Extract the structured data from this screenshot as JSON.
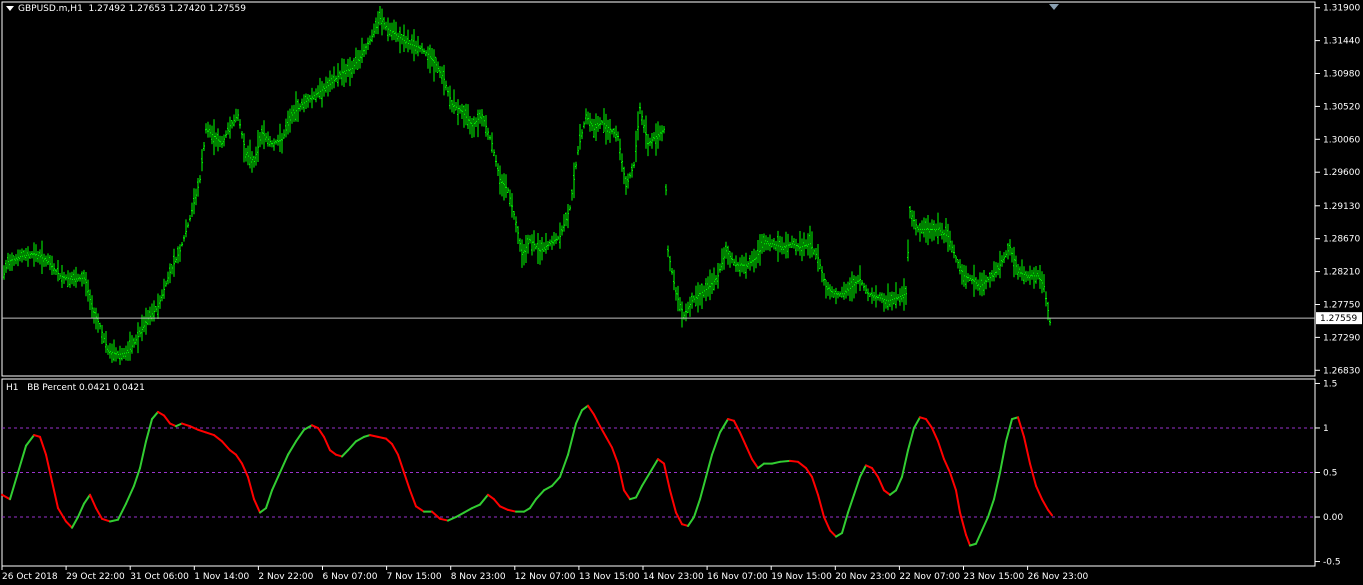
{
  "main_header": {
    "symbol": "GBPUSD.m,H1",
    "ohlc": "1.27492 1.27653 1.27420 1.27559"
  },
  "indicator_header": {
    "timeframe": "H1",
    "label": "BB Percent 0.0421 0.0421"
  },
  "colors": {
    "background": "#000000",
    "frame": "#ffffff",
    "bars": "#00ff00",
    "bb_up": "#32cd32",
    "bb_down": "#ff0000",
    "level_lines": "#9932cc",
    "price_line": "#c0c0c0"
  },
  "icons": {
    "collapse": "triangle-down-icon",
    "scroll_marker": "triangle-down-icon"
  },
  "chart_data": [
    {
      "type": "ohlc",
      "symbol": "GBPUSD.m",
      "timeframe": "H1",
      "y_ticks": [
        1.319,
        1.3144,
        1.3098,
        1.3052,
        1.3006,
        1.296,
        1.2913,
        1.2867,
        1.2821,
        1.2775,
        1.2729,
        1.2683
      ],
      "y_tick_labels": [
        "1.31900",
        "1.31440",
        "1.30980",
        "1.30520",
        "1.30060",
        "1.29600",
        "1.29130",
        "1.28670",
        "1.28210",
        "1.27750",
        "1.27290",
        "1.26830"
      ],
      "ylim": [
        1.2675,
        1.3198
      ],
      "current_price": 1.27559,
      "current_price_label": "1.27559",
      "close_path": [
        [
          0,
          1.28
        ],
        [
          8,
          1.2835
        ],
        [
          20,
          1.2842
        ],
        [
          35,
          1.2846
        ],
        [
          48,
          1.2835
        ],
        [
          60,
          1.2815
        ],
        [
          72,
          1.281
        ],
        [
          85,
          1.2812
        ],
        [
          92,
          1.277
        ],
        [
          100,
          1.2745
        ],
        [
          108,
          1.271
        ],
        [
          118,
          1.2705
        ],
        [
          128,
          1.2708
        ],
        [
          138,
          1.273
        ],
        [
          148,
          1.2755
        ],
        [
          158,
          1.2772
        ],
        [
          170,
          1.282
        ],
        [
          180,
          1.285
        ],
        [
          190,
          1.2895
        ],
        [
          200,
          1.295
        ],
        [
          206,
          1.302
        ],
        [
          214,
          1.301
        ],
        [
          222,
          1.3
        ],
        [
          230,
          1.3025
        ],
        [
          238,
          1.304
        ],
        [
          246,
          1.2985
        ],
        [
          254,
          1.2975
        ],
        [
          262,
          1.3015
        ],
        [
          272,
          1.3
        ],
        [
          282,
          1.3005
        ],
        [
          292,
          1.304
        ],
        [
          302,
          1.3055
        ],
        [
          312,
          1.3065
        ],
        [
          322,
          1.3075
        ],
        [
          332,
          1.3085
        ],
        [
          342,
          1.31
        ],
        [
          352,
          1.3105
        ],
        [
          362,
          1.3125
        ],
        [
          372,
          1.315
        ],
        [
          380,
          1.3175
        ],
        [
          388,
          1.316
        ],
        [
          398,
          1.315
        ],
        [
          408,
          1.314
        ],
        [
          418,
          1.3135
        ],
        [
          428,
          1.3125
        ],
        [
          436,
          1.311
        ],
        [
          444,
          1.309
        ],
        [
          452,
          1.3055
        ],
        [
          462,
          1.3045
        ],
        [
          472,
          1.3025
        ],
        [
          482,
          1.304
        ],
        [
          492,
          1.3
        ],
        [
          500,
          1.295
        ],
        [
          508,
          1.2935
        ],
        [
          516,
          1.289
        ],
        [
          522,
          1.2845
        ],
        [
          530,
          1.2865
        ],
        [
          540,
          1.285
        ],
        [
          550,
          1.286
        ],
        [
          560,
          1.287
        ],
        [
          570,
          1.291
        ],
        [
          578,
          1.299
        ],
        [
          586,
          1.304
        ],
        [
          594,
          1.302
        ],
        [
          602,
          1.303
        ],
        [
          610,
          1.302
        ],
        [
          618,
          1.301
        ],
        [
          626,
          1.294
        ],
        [
          634,
          1.297
        ],
        [
          640,
          1.305
        ],
        [
          648,
          1.3
        ],
        [
          656,
          1.301
        ],
        [
          664,
          1.302
        ],
        [
          668,
          1.285
        ],
        [
          676,
          1.279
        ],
        [
          684,
          1.276
        ],
        [
          692,
          1.278
        ],
        [
          700,
          1.279
        ],
        [
          710,
          1.28
        ],
        [
          718,
          1.2815
        ],
        [
          726,
          1.285
        ],
        [
          736,
          1.283
        ],
        [
          746,
          1.283
        ],
        [
          756,
          1.284
        ],
        [
          764,
          1.286
        ],
        [
          772,
          1.286
        ],
        [
          782,
          1.2855
        ],
        [
          792,
          1.286
        ],
        [
          800,
          1.2855
        ],
        [
          810,
          1.286
        ],
        [
          818,
          1.284
        ],
        [
          826,
          1.28
        ],
        [
          834,
          1.279
        ],
        [
          844,
          1.279
        ],
        [
          852,
          1.28
        ],
        [
          860,
          1.281
        ],
        [
          868,
          1.279
        ],
        [
          878,
          1.2785
        ],
        [
          888,
          1.278
        ],
        [
          898,
          1.2785
        ],
        [
          906,
          1.279
        ],
        [
          910,
          1.2905
        ],
        [
          918,
          1.288
        ],
        [
          928,
          1.288
        ],
        [
          938,
          1.288
        ],
        [
          948,
          1.287
        ],
        [
          956,
          1.284
        ],
        [
          964,
          1.2815
        ],
        [
          972,
          1.281
        ],
        [
          980,
          1.28
        ],
        [
          988,
          1.281
        ],
        [
          996,
          1.282
        ],
        [
          1004,
          1.284
        ],
        [
          1010,
          1.2855
        ],
        [
          1018,
          1.282
        ],
        [
          1028,
          1.2815
        ],
        [
          1038,
          1.2815
        ],
        [
          1044,
          1.28
        ],
        [
          1050,
          1.275
        ]
      ]
    },
    {
      "type": "line",
      "title": "BB Percent 0.0421 0.0421",
      "y_ticks": [
        1.5,
        1,
        0.5,
        0.0,
        -0.5
      ],
      "y_tick_labels": [
        "1.5",
        "1",
        "0.5",
        "0.00",
        "-0.5"
      ],
      "level_lines": [
        1,
        0.5,
        0
      ],
      "ylim": [
        -0.55,
        1.55
      ],
      "x_tick_labels": [
        "26 Oct 2018",
        "29 Oct 22:00",
        "31 Oct 06:00",
        "1 Nov 14:00",
        "2 Nov 22:00",
        "6 Nov 07:00",
        "7 Nov 15:00",
        "8 Nov 23:00",
        "12 Nov 07:00",
        "13 Nov 15:00",
        "14 Nov 23:00",
        "16 Nov 07:00",
        "19 Nov 15:00",
        "20 Nov 23:00",
        "22 Nov 07:00",
        "23 Nov 15:00",
        "26 Nov 23:00"
      ],
      "points": [
        [
          2,
          0.25
        ],
        [
          10,
          0.2
        ],
        [
          18,
          0.5
        ],
        [
          26,
          0.8
        ],
        [
          34,
          0.92
        ],
        [
          40,
          0.9
        ],
        [
          46,
          0.7
        ],
        [
          52,
          0.4
        ],
        [
          58,
          0.1
        ],
        [
          66,
          -0.05
        ],
        [
          72,
          -0.12
        ],
        [
          78,
          0.0
        ],
        [
          84,
          0.15
        ],
        [
          90,
          0.25
        ],
        [
          96,
          0.1
        ],
        [
          102,
          -0.02
        ],
        [
          110,
          -0.05
        ],
        [
          118,
          -0.03
        ],
        [
          126,
          0.15
        ],
        [
          134,
          0.35
        ],
        [
          140,
          0.55
        ],
        [
          146,
          0.85
        ],
        [
          152,
          1.1
        ],
        [
          158,
          1.18
        ],
        [
          164,
          1.14
        ],
        [
          170,
          1.05
        ],
        [
          176,
          1.02
        ],
        [
          182,
          1.05
        ],
        [
          190,
          1.02
        ],
        [
          198,
          0.98
        ],
        [
          206,
          0.95
        ],
        [
          214,
          0.92
        ],
        [
          222,
          0.85
        ],
        [
          230,
          0.75
        ],
        [
          236,
          0.7
        ],
        [
          242,
          0.6
        ],
        [
          248,
          0.45
        ],
        [
          254,
          0.2
        ],
        [
          260,
          0.05
        ],
        [
          266,
          0.1
        ],
        [
          272,
          0.3
        ],
        [
          280,
          0.5
        ],
        [
          288,
          0.7
        ],
        [
          296,
          0.85
        ],
        [
          304,
          0.98
        ],
        [
          312,
          1.03
        ],
        [
          318,
          1.0
        ],
        [
          324,
          0.9
        ],
        [
          330,
          0.75
        ],
        [
          336,
          0.7
        ],
        [
          342,
          0.68
        ],
        [
          348,
          0.75
        ],
        [
          356,
          0.85
        ],
        [
          364,
          0.9
        ],
        [
          370,
          0.92
        ],
        [
          378,
          0.9
        ],
        [
          386,
          0.88
        ],
        [
          392,
          0.82
        ],
        [
          398,
          0.7
        ],
        [
          404,
          0.5
        ],
        [
          410,
          0.3
        ],
        [
          416,
          0.12
        ],
        [
          424,
          0.06
        ],
        [
          432,
          0.06
        ],
        [
          440,
          -0.02
        ],
        [
          448,
          -0.04
        ],
        [
          456,
          0.0
        ],
        [
          464,
          0.05
        ],
        [
          472,
          0.1
        ],
        [
          480,
          0.14
        ],
        [
          488,
          0.25
        ],
        [
          494,
          0.2
        ],
        [
          500,
          0.12
        ],
        [
          508,
          0.08
        ],
        [
          516,
          0.06
        ],
        [
          524,
          0.06
        ],
        [
          530,
          0.1
        ],
        [
          536,
          0.2
        ],
        [
          544,
          0.3
        ],
        [
          552,
          0.35
        ],
        [
          560,
          0.45
        ],
        [
          568,
          0.7
        ],
        [
          576,
          1.05
        ],
        [
          582,
          1.2
        ],
        [
          588,
          1.25
        ],
        [
          594,
          1.15
        ],
        [
          600,
          1.02
        ],
        [
          606,
          0.9
        ],
        [
          612,
          0.78
        ],
        [
          618,
          0.6
        ],
        [
          624,
          0.3
        ],
        [
          630,
          0.2
        ],
        [
          636,
          0.22
        ],
        [
          642,
          0.35
        ],
        [
          650,
          0.5
        ],
        [
          658,
          0.65
        ],
        [
          664,
          0.6
        ],
        [
          670,
          0.3
        ],
        [
          676,
          0.05
        ],
        [
          682,
          -0.08
        ],
        [
          688,
          -0.1
        ],
        [
          694,
          0.0
        ],
        [
          700,
          0.2
        ],
        [
          706,
          0.45
        ],
        [
          712,
          0.7
        ],
        [
          720,
          0.95
        ],
        [
          728,
          1.1
        ],
        [
          734,
          1.08
        ],
        [
          740,
          0.95
        ],
        [
          746,
          0.8
        ],
        [
          752,
          0.65
        ],
        [
          758,
          0.55
        ],
        [
          764,
          0.6
        ],
        [
          772,
          0.6
        ],
        [
          780,
          0.62
        ],
        [
          790,
          0.63
        ],
        [
          798,
          0.62
        ],
        [
          806,
          0.55
        ],
        [
          812,
          0.45
        ],
        [
          818,
          0.25
        ],
        [
          824,
          0.0
        ],
        [
          830,
          -0.15
        ],
        [
          836,
          -0.22
        ],
        [
          842,
          -0.18
        ],
        [
          848,
          0.05
        ],
        [
          854,
          0.25
        ],
        [
          860,
          0.45
        ],
        [
          866,
          0.58
        ],
        [
          872,
          0.55
        ],
        [
          878,
          0.45
        ],
        [
          884,
          0.3
        ],
        [
          890,
          0.25
        ],
        [
          896,
          0.3
        ],
        [
          902,
          0.45
        ],
        [
          908,
          0.75
        ],
        [
          914,
          1.0
        ],
        [
          920,
          1.12
        ],
        [
          926,
          1.1
        ],
        [
          932,
          1.0
        ],
        [
          938,
          0.85
        ],
        [
          944,
          0.65
        ],
        [
          950,
          0.5
        ],
        [
          956,
          0.3
        ],
        [
          960,
          0.05
        ],
        [
          966,
          -0.2
        ],
        [
          970,
          -0.32
        ],
        [
          976,
          -0.3
        ],
        [
          982,
          -0.15
        ],
        [
          988,
          0.0
        ],
        [
          994,
          0.2
        ],
        [
          1000,
          0.5
        ],
        [
          1006,
          0.85
        ],
        [
          1012,
          1.1
        ],
        [
          1018,
          1.12
        ],
        [
          1024,
          0.9
        ],
        [
          1030,
          0.6
        ],
        [
          1036,
          0.35
        ],
        [
          1042,
          0.2
        ],
        [
          1048,
          0.08
        ],
        [
          1052,
          0.02
        ]
      ]
    }
  ]
}
